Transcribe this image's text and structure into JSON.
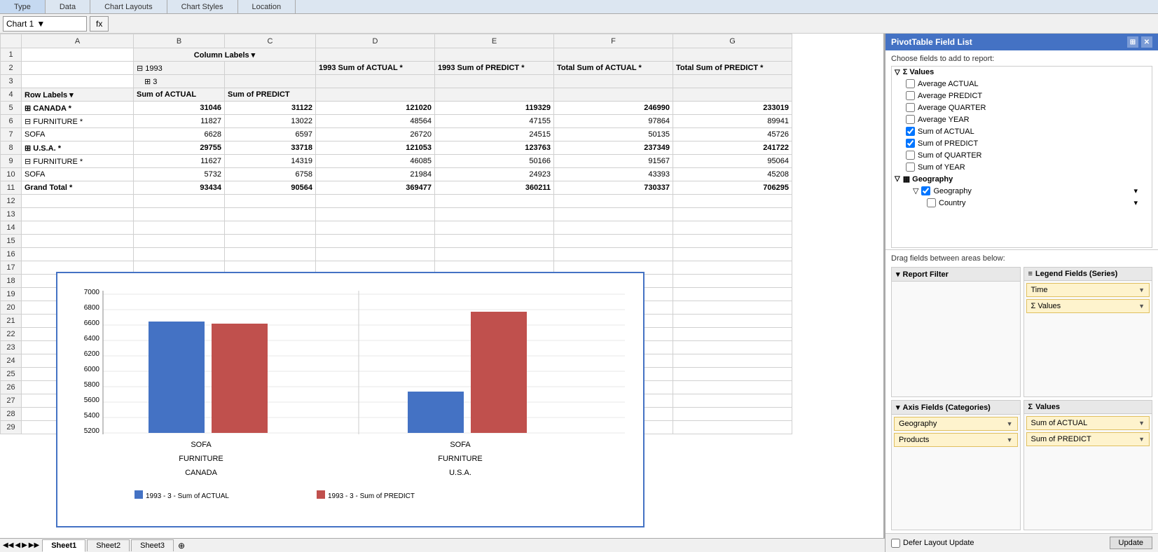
{
  "toolbar": {
    "chart_name": "Chart 1",
    "fx_label": "fx",
    "tabs": [
      "Type",
      "Data",
      "Chart Layouts",
      "Chart Styles",
      "Location"
    ]
  },
  "grid": {
    "col_headers": [
      "A",
      "B",
      "C",
      "D",
      "E",
      "F",
      "G"
    ],
    "row1": {
      "b": "Column Labels ▾"
    },
    "row2": {
      "b": "⊟ 1993",
      "d": "1993 Sum of ACTUAL *",
      "e": "1993 Sum of PREDICT *",
      "f": "Total Sum of ACTUAL *",
      "g": "Total Sum of PREDICT *"
    },
    "row3": {
      "b": "⊞  3"
    },
    "row4": {
      "a": "Row Labels  ▾",
      "b": "Sum of ACTUAL",
      "c": "Sum of PREDICT"
    },
    "rows": [
      {
        "num": 5,
        "a": "⊞ CANADA *",
        "b": "31046",
        "c": "31122",
        "d": "121020",
        "e": "119329",
        "f": "246990",
        "g": "233019",
        "bold": true
      },
      {
        "num": 6,
        "a": "⊟ FURNITURE *",
        "b": "11827",
        "c": "13022",
        "d": "48564",
        "e": "47155",
        "f": "97864",
        "g": "89941",
        "bold": false,
        "indent": true
      },
      {
        "num": 7,
        "a": "    SOFA",
        "b": "6628",
        "c": "6597",
        "d": "26720",
        "e": "24515",
        "f": "50135",
        "g": "45726",
        "bold": false
      },
      {
        "num": 8,
        "a": "⊞ U.S.A. *",
        "b": "29755",
        "c": "33718",
        "d": "121053",
        "e": "123763",
        "f": "237349",
        "g": "241722",
        "bold": true
      },
      {
        "num": 9,
        "a": "⊟ FURNITURE *",
        "b": "11627",
        "c": "14319",
        "d": "46085",
        "e": "50166",
        "f": "91567",
        "g": "95064",
        "bold": false,
        "indent": true
      },
      {
        "num": 10,
        "a": "    SOFA",
        "b": "5732",
        "c": "6758",
        "d": "21984",
        "e": "24923",
        "f": "43393",
        "g": "45208",
        "bold": false
      },
      {
        "num": 11,
        "a": "Grand Total *",
        "b": "93434",
        "c": "90564",
        "d": "369477",
        "e": "360211",
        "f": "730337",
        "g": "706295",
        "bold": true
      }
    ]
  },
  "chart": {
    "title": "",
    "y_axis": [
      "7000",
      "6800",
      "6600",
      "6400",
      "6200",
      "6000",
      "5800",
      "5600",
      "5400",
      "5200"
    ],
    "groups": [
      {
        "label_bottom": "CANADA",
        "sublabel": "FURNITURE",
        "bar_label": "SOFA",
        "bars": [
          {
            "value": 6628,
            "color": "#4472c4"
          },
          {
            "value": 6597,
            "color": "#c0504d"
          }
        ]
      },
      {
        "label_bottom": "U.S.A.",
        "sublabel": "FURNITURE",
        "bar_label": "SOFA",
        "bars": [
          {
            "value": 5732,
            "color": "#4472c4"
          },
          {
            "value": 6758,
            "color": "#c0504d"
          }
        ]
      }
    ],
    "legend": [
      {
        "color": "#4472c4",
        "label": "1993 -     3 - Sum of ACTUAL"
      },
      {
        "color": "#c0504d",
        "label": "1993 -     3 - Sum of PREDICT"
      }
    ]
  },
  "pivot": {
    "title": "PivotTable Field List",
    "choose_label": "Choose fields to add to report:",
    "values_section": "Values",
    "fields": [
      {
        "label": "Average ACTUAL",
        "checked": false
      },
      {
        "label": "Average PREDICT",
        "checked": false
      },
      {
        "label": "Average QUARTER",
        "checked": false
      },
      {
        "label": "Average YEAR",
        "checked": false
      },
      {
        "label": "Sum of ACTUAL",
        "checked": true
      },
      {
        "label": "Sum of PREDICT",
        "checked": true
      },
      {
        "label": "Sum of QUARTER",
        "checked": false
      },
      {
        "label": "Sum of YEAR",
        "checked": false
      }
    ],
    "geography_section": "Geography",
    "geography_fields": [
      {
        "label": "Geography",
        "checked": true
      },
      {
        "label": "Country",
        "checked": false
      }
    ],
    "drag_label": "Drag fields between areas below:",
    "areas": {
      "report_filter": {
        "label": "Report Filter",
        "icon": "▾",
        "items": []
      },
      "legend_fields": {
        "label": "Legend Fields (Series)",
        "icon": "≡",
        "items": [
          "Time",
          "Σ  Values"
        ]
      },
      "axis_fields": {
        "label": "Axis Fields (Categories)",
        "icon": "▾",
        "items": [
          "Geography",
          "Products"
        ]
      },
      "values": {
        "label": "Values",
        "icon": "Σ",
        "items": [
          "Sum of ACTUAL",
          "Sum of PREDICT"
        ]
      }
    },
    "defer_layout": "Defer Layout Update",
    "update_btn": "Update"
  },
  "sheets": [
    "Sheet1",
    "Sheet2",
    "Sheet3"
  ],
  "active_sheet": "Sheet1"
}
